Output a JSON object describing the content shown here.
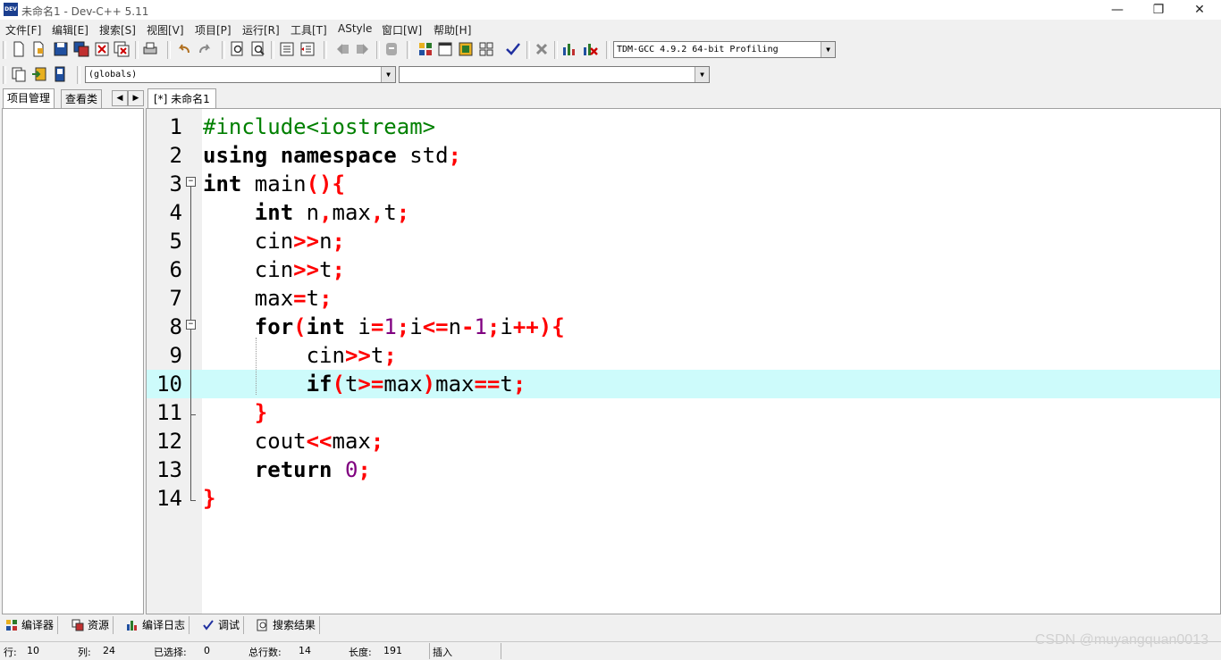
{
  "window": {
    "title": "未命名1 - Dev-C++ 5.11",
    "app_icon_text": "DEV",
    "controls": [
      "—",
      "❐",
      "✕"
    ]
  },
  "menu": [
    "文件[F]",
    "编辑[E]",
    "搜索[S]",
    "视图[V]",
    "项目[P]",
    "运行[R]",
    "工具[T]",
    "AStyle",
    "窗口[W]",
    "帮助[H]"
  ],
  "toolbar": {
    "compiler_select": "TDM-GCC 4.9.2 64-bit Profiling",
    "scope_select": "(globals)",
    "member_select": ""
  },
  "left_panel": {
    "tabs": [
      "项目管理",
      "查看类"
    ],
    "nav": [
      "◀",
      "▶"
    ]
  },
  "editor": {
    "tab_label": "[*] 未命名1",
    "current_line": 10,
    "lines": [
      {
        "n": "1",
        "tokens": [
          [
            "pre",
            "#include<iostream>"
          ]
        ]
      },
      {
        "n": "2",
        "tokens": [
          [
            "kw",
            "using"
          ],
          [
            "id",
            " "
          ],
          [
            "kw",
            "namespace"
          ],
          [
            "id",
            " std"
          ],
          [
            "sym",
            ";"
          ]
        ]
      },
      {
        "n": "3",
        "tokens": [
          [
            "kw",
            "int"
          ],
          [
            "id",
            " main"
          ],
          [
            "sym",
            "(){"
          ]
        ]
      },
      {
        "n": "4",
        "tokens": [
          [
            "id",
            "    "
          ],
          [
            "kw",
            "int"
          ],
          [
            "id",
            " n"
          ],
          [
            "sym",
            ","
          ],
          [
            "id",
            "max"
          ],
          [
            "sym",
            ","
          ],
          [
            "id",
            "t"
          ],
          [
            "sym",
            ";"
          ]
        ]
      },
      {
        "n": "5",
        "tokens": [
          [
            "id",
            "    cin"
          ],
          [
            "sym",
            ">>"
          ],
          [
            "id",
            "n"
          ],
          [
            "sym",
            ";"
          ]
        ]
      },
      {
        "n": "6",
        "tokens": [
          [
            "id",
            "    cin"
          ],
          [
            "sym",
            ">>"
          ],
          [
            "id",
            "t"
          ],
          [
            "sym",
            ";"
          ]
        ]
      },
      {
        "n": "7",
        "tokens": [
          [
            "id",
            "    max"
          ],
          [
            "sym",
            "="
          ],
          [
            "id",
            "t"
          ],
          [
            "sym",
            ";"
          ]
        ]
      },
      {
        "n": "8",
        "tokens": [
          [
            "id",
            "    "
          ],
          [
            "kw",
            "for"
          ],
          [
            "sym",
            "("
          ],
          [
            "kw",
            "int"
          ],
          [
            "id",
            " i"
          ],
          [
            "sym",
            "="
          ],
          [
            "num",
            "1"
          ],
          [
            "sym",
            ";"
          ],
          [
            "id",
            "i"
          ],
          [
            "sym",
            "<="
          ],
          [
            "id",
            "n"
          ],
          [
            "sym",
            "-"
          ],
          [
            "num",
            "1"
          ],
          [
            "sym",
            ";"
          ],
          [
            "id",
            "i"
          ],
          [
            "sym",
            "++){"
          ]
        ]
      },
      {
        "n": "9",
        "tokens": [
          [
            "id",
            "        cin"
          ],
          [
            "sym",
            ">>"
          ],
          [
            "id",
            "t"
          ],
          [
            "sym",
            ";"
          ]
        ]
      },
      {
        "n": "10",
        "tokens": [
          [
            "id",
            "        "
          ],
          [
            "kw",
            "if"
          ],
          [
            "sym",
            "("
          ],
          [
            "id",
            "t"
          ],
          [
            "sym",
            ">="
          ],
          [
            "id",
            "max"
          ],
          [
            "sym",
            ")"
          ],
          [
            "id",
            "max"
          ],
          [
            "sym",
            "=="
          ],
          [
            "id",
            "t"
          ],
          [
            "sym",
            ";"
          ]
        ]
      },
      {
        "n": "11",
        "tokens": [
          [
            "id",
            "    "
          ],
          [
            "sym",
            "}"
          ]
        ]
      },
      {
        "n": "12",
        "tokens": [
          [
            "id",
            "    cout"
          ],
          [
            "sym",
            "<<"
          ],
          [
            "id",
            "max"
          ],
          [
            "sym",
            ";"
          ]
        ]
      },
      {
        "n": "13",
        "tokens": [
          [
            "id",
            "    "
          ],
          [
            "kw",
            "return"
          ],
          [
            "id",
            " "
          ],
          [
            "num",
            "0"
          ],
          [
            "sym",
            ";"
          ]
        ]
      },
      {
        "n": "14",
        "tokens": [
          [
            "sym",
            "}"
          ]
        ]
      }
    ]
  },
  "bottom_tabs": [
    "编译器",
    "资源",
    "编译日志",
    "调试",
    "搜索结果"
  ],
  "status": {
    "row_label": "行:",
    "row_value": "10",
    "col_label": "列:",
    "col_value": "24",
    "sel_label": "已选择:",
    "sel_value": "0",
    "total_label": "总行数:",
    "total_value": "14",
    "len_label": "长度:",
    "len_value": "191",
    "mode": "插入"
  },
  "watermark": "CSDN @muyangquan0013"
}
